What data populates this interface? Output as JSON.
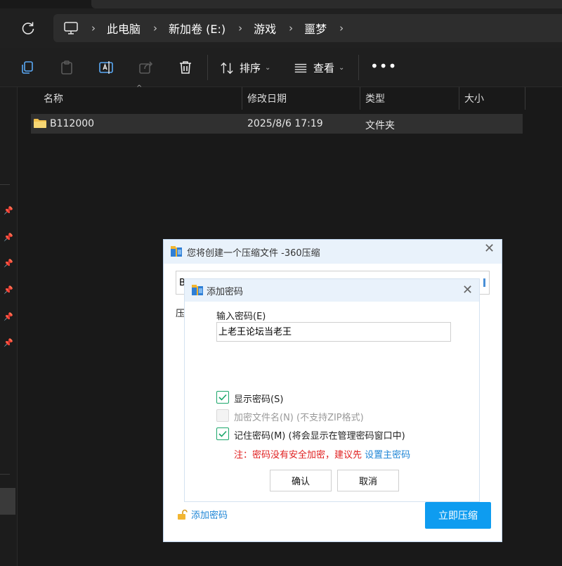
{
  "explorer": {
    "breadcrumb": [
      "此电脑",
      "新加卷 (E:)",
      "游戏",
      "噩梦"
    ],
    "toolbar": {
      "sort_label": "排序",
      "view_label": "查看",
      "more_label": "•••"
    },
    "columns": [
      "名称",
      "修改日期",
      "类型",
      "大小"
    ],
    "rows": [
      {
        "name": "B112000",
        "modified": "2025/8/6 17:19",
        "type": "文件夹",
        "size": ""
      }
    ]
  },
  "compress_dialog": {
    "title": "您将创建一个压缩文件 -360压缩",
    "path_visible": "B",
    "side_label_visible": "压",
    "add_password_link": "添加密码",
    "start_button": "立即压缩"
  },
  "password_dialog": {
    "title": "添加密码",
    "input_label": "输入密码(E)",
    "password_value": "上老王论坛当老王",
    "show_password": {
      "label": "显示密码(S)",
      "checked": true
    },
    "encrypt_filenames": {
      "label": "加密文件名(N) (不支持ZIP格式)",
      "checked": false,
      "disabled": true
    },
    "remember_password": {
      "label": "记住密码(M) (将会显示在管理密码窗口中)",
      "checked": true
    },
    "warning_text": "注：密码没有安全加密，建议先",
    "warning_link": "设置主密码",
    "ok_button": "确认",
    "cancel_button": "取消"
  },
  "colors": {
    "accent": "#0e9cf0",
    "check_green": "#1aa66a",
    "warning_red": "#e02020",
    "link_blue": "#1f86d6"
  }
}
